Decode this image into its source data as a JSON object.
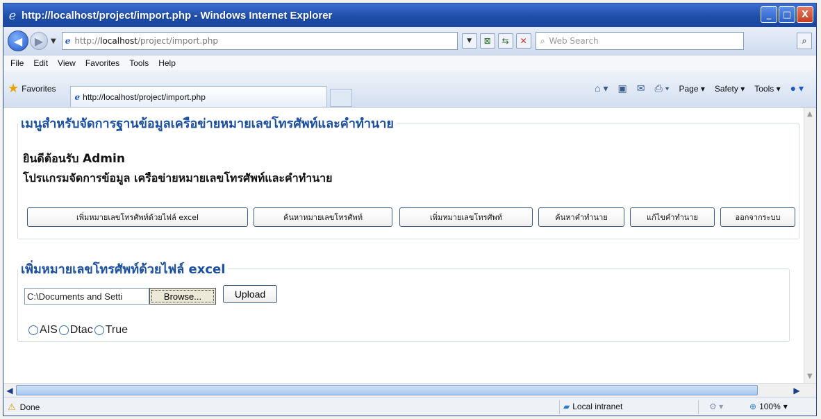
{
  "window": {
    "title": "http://localhost/project/import.php - Windows Internet Explorer",
    "controls": {
      "minimize": "_",
      "maximize": "□",
      "close": "X"
    }
  },
  "address_bar": {
    "url_prefix": "http://",
    "url_host": "localhost",
    "url_path": "/project/import.php",
    "search_placeholder": "Web Search"
  },
  "menu": {
    "items": [
      "File",
      "Edit",
      "View",
      "Favorites",
      "Tools",
      "Help"
    ]
  },
  "favorites_bar": {
    "favorites_label": "Favorites",
    "tab_title": "http://localhost/project/import.php",
    "command_items": [
      "Page ▾",
      "Safety ▾",
      "Tools ▾"
    ]
  },
  "page": {
    "menu_legend": "เมนูสำหรับจัดการฐานข้อมูลเครือข่ายหมายเลขโทรศัพท์และคำทำนาย",
    "welcome_prefix": "ยินดีต้อนรับ",
    "welcome_user": "Admin",
    "program_text": "โปรแกรมจัดการข้อมูล เครือข่ายหมายเลขโทรศัพท์และคำทำนาย",
    "menu_buttons": [
      "เพิ่มหมายเลขโทรศัพท์ด้วยไฟล์ excel",
      "ค้นหาหมายเลขโทรศัพท์",
      "เพิ่มหมายเลขโทรศัพท์",
      "ค้นหาคำทำนาย",
      "แก้ไขคำทำนาย",
      "ออกจากระบบ"
    ],
    "upload_legend": "เพิ่มหมายเลขโทรศัพท์ด้วยไฟล์ excel",
    "file_value": "C:\\Documents and Setti",
    "browse_label": "Browse...",
    "upload_label": "Upload",
    "radio_options": [
      "AIS",
      "Dtac",
      "True"
    ]
  },
  "status_bar": {
    "status_text": "Done",
    "zone": "Local intranet",
    "zoom": "100%"
  }
}
